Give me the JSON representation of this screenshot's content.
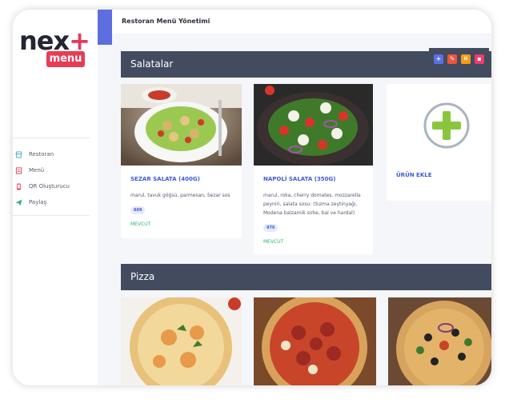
{
  "brand": {
    "logo_text": "nex",
    "logo_plus": "+",
    "badge": "menu"
  },
  "sidebar": {
    "items": [
      {
        "label": "Restoran",
        "icon": "store-icon",
        "color": "#3aa6c9"
      },
      {
        "label": "Menü",
        "icon": "menu-list-icon",
        "color": "#e5375a"
      },
      {
        "label": "QR Oluşturucu",
        "icon": "qr-phone-icon",
        "color": "#e5375a"
      },
      {
        "label": "Paylaş",
        "icon": "send-icon",
        "color": "#2bb673"
      }
    ]
  },
  "header": {
    "title": "Restoran Menü Yönetimi"
  },
  "sections": [
    {
      "title": "Salatalar",
      "actions": [
        {
          "icon": "plus-icon",
          "glyph": "+",
          "color": "#5b6fe3"
        },
        {
          "icon": "edit-icon",
          "glyph": "✎",
          "color": "#f0533a"
        },
        {
          "icon": "pause-icon",
          "glyph": "II",
          "color": "#f59c1a"
        },
        {
          "icon": "trash-icon",
          "glyph": "▪",
          "color": "#ef3b6c"
        }
      ],
      "products": [
        {
          "name": "SEZAR SALATA (400G)",
          "desc": "marul, tavuk göğsü, parmesan, Sezar sos",
          "badge": "609",
          "status": "MEVCUT"
        },
        {
          "name": "NAPOLİ SALATA (350G)",
          "desc": "marul, roka, cherry domates, mozzarella peyniri, salata sosu: (Sızma zeytinyağı, Modena balzamik sirke, bal ve hardal)",
          "badge": "976",
          "status": "MEVCUT"
        }
      ],
      "add_label": "ÜRÜN EKLE"
    },
    {
      "title": "Pizza"
    }
  ],
  "colors": {
    "accent": "#5c6ee0",
    "header_bg": "#434b5e",
    "add_green": "#8bc53f",
    "link_blue": "#3b5bdb"
  }
}
